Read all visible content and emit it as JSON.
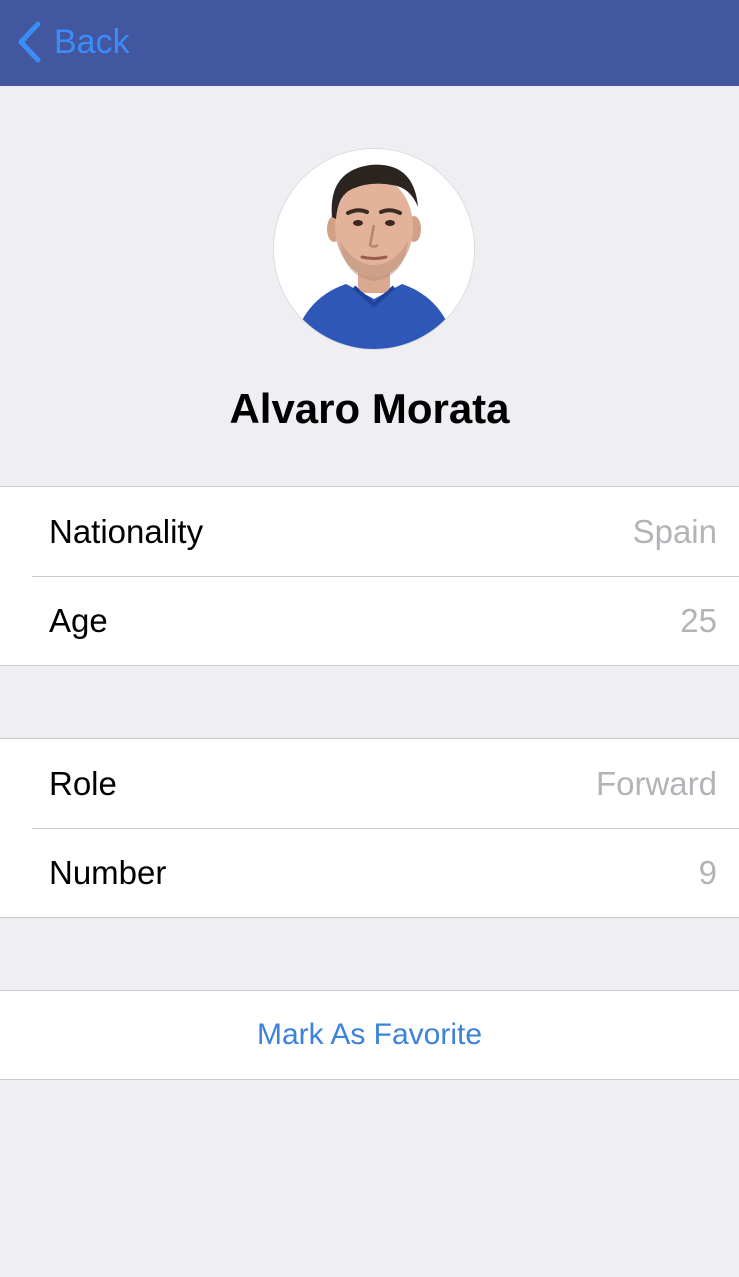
{
  "navbar": {
    "back_label": "Back",
    "back_icon": "chevron-left-icon",
    "background_color": "#4357a0",
    "accent_color": "#3b8df5"
  },
  "player": {
    "name": "Alvaro Morata",
    "photo": "player-portrait"
  },
  "info_group": [
    {
      "label": "Nationality",
      "value": "Spain"
    },
    {
      "label": "Age",
      "value": "25"
    }
  ],
  "role_group": [
    {
      "label": "Role",
      "value": "Forward"
    },
    {
      "label": "Number",
      "value": "9"
    }
  ],
  "actions": {
    "favorite_label": "Mark As Favorite"
  }
}
